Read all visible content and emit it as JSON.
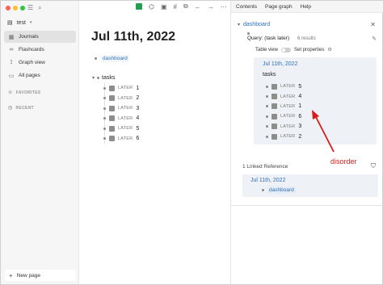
{
  "sidebar": {
    "graph_name": "test",
    "nav_items": [
      {
        "label": "Journals",
        "icon": "calendar-icon",
        "active": true
      },
      {
        "label": "Flashcards",
        "icon": "infinity-icon",
        "active": false
      },
      {
        "label": "Graph view",
        "icon": "graph-icon",
        "active": false
      },
      {
        "label": "All pages",
        "icon": "pages-icon",
        "active": false
      }
    ],
    "favorites_label": "FAVORITES",
    "recent_label": "RECENT",
    "new_page_label": "New page"
  },
  "main": {
    "title": "Jul 11th, 2022",
    "tag": "dashboard",
    "tasks_label": "tasks",
    "tasks": [
      {
        "marker": "LATER",
        "text": "1"
      },
      {
        "marker": "LATER",
        "text": "2"
      },
      {
        "marker": "LATER",
        "text": "3"
      },
      {
        "marker": "LATER",
        "text": "4"
      },
      {
        "marker": "LATER",
        "text": "5"
      },
      {
        "marker": "LATER",
        "text": "6"
      }
    ]
  },
  "right_panel": {
    "tabs": [
      "Contents",
      "Page graph",
      "Help"
    ],
    "page_title": "dashboard",
    "query_label": "Query: (task later)",
    "results": "6 results",
    "table_view_label": "Table view",
    "set_properties_label": "Set properties",
    "result_date": "Jul 11th, 2022",
    "result_tasks_label": "tasks",
    "result_tasks": [
      {
        "marker": "LATER",
        "text": "5"
      },
      {
        "marker": "LATER",
        "text": "4"
      },
      {
        "marker": "LATER",
        "text": "1"
      },
      {
        "marker": "LATER",
        "text": "6"
      },
      {
        "marker": "LATER",
        "text": "3"
      },
      {
        "marker": "LATER",
        "text": "2"
      }
    ],
    "linked_reference_label": "1 Linked Reference",
    "linked_date": "Jul 11th, 2022",
    "linked_tag": "dashboard"
  },
  "annotation": {
    "text": "disorder",
    "color": "#d81b1b"
  },
  "colors": {
    "link": "#2e6fbd",
    "green": "#22a04b",
    "close_red": "#ff5f57",
    "min_yellow": "#febc2e",
    "max_green": "#28c840"
  }
}
